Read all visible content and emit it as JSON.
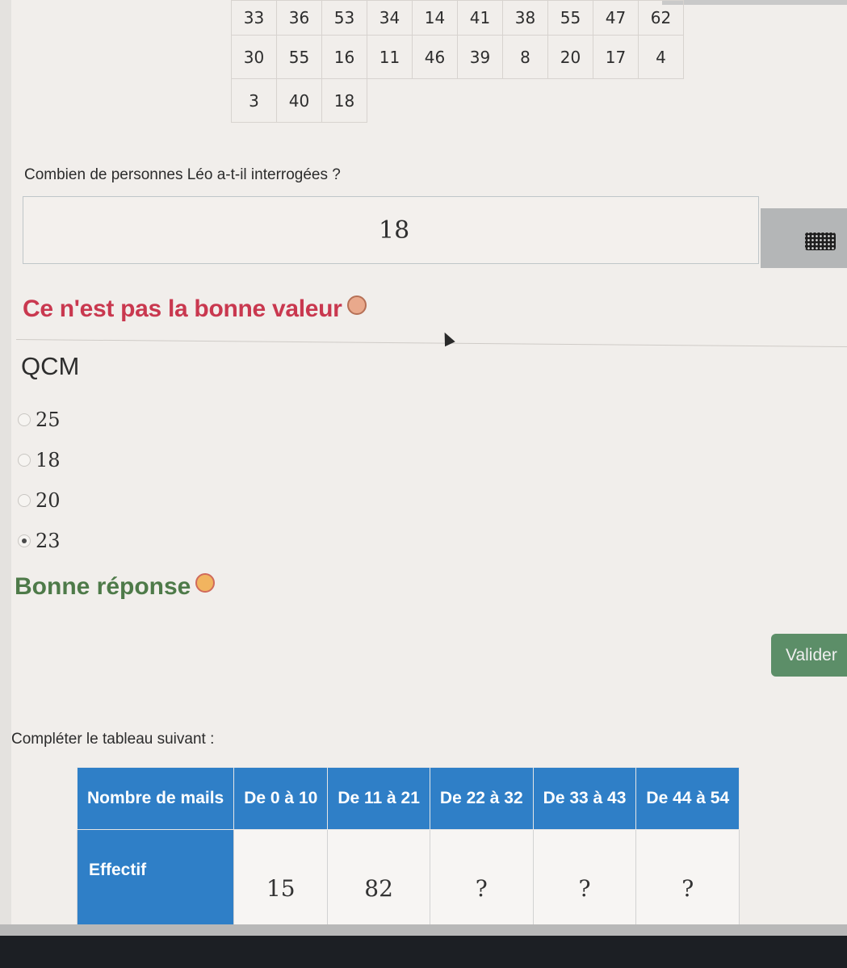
{
  "data_table": {
    "rows": [
      [
        "33",
        "36",
        "53",
        "34",
        "14",
        "41",
        "38",
        "55",
        "47",
        "62"
      ],
      [
        "30",
        "55",
        "16",
        "11",
        "46",
        "39",
        "8",
        "20",
        "17",
        "4"
      ],
      [
        "3",
        "40",
        "18"
      ]
    ]
  },
  "question": "Combien de personnes Léo a-t-il interrogées ?",
  "answer": {
    "value": "18"
  },
  "feedback_wrong": "Ce n'est pas la bonne valeur",
  "qcm": {
    "title": "QCM",
    "options": [
      {
        "label": "25",
        "selected": false
      },
      {
        "label": "18",
        "selected": false
      },
      {
        "label": "20",
        "selected": false
      },
      {
        "label": "23",
        "selected": true
      }
    ]
  },
  "feedback_right": "Bonne réponse",
  "validate_label": "Valider",
  "instruction": "Compléter le tableau suivant :",
  "freq_table": {
    "headers": [
      "Nombre de mails",
      "De 0 à 10",
      "De 11 à 21",
      "De 22 à 32",
      "De 33 à 43",
      "De 44 à 54"
    ],
    "row_label": "Effectif",
    "values": [
      "15",
      "82",
      "?",
      "?",
      "?"
    ]
  },
  "colors": {
    "accent_blue": "#2f7fc7",
    "error_red": "#c9384f",
    "success_green": "#4e7a49",
    "button_green": "#5c8e68"
  }
}
